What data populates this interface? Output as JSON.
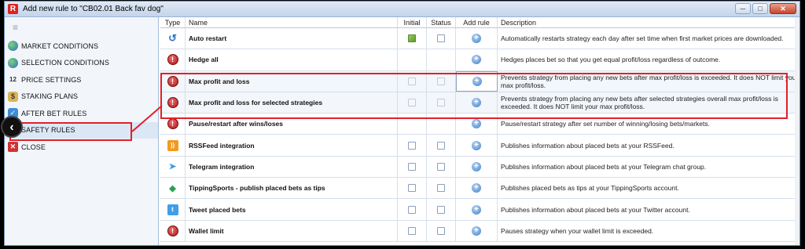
{
  "window": {
    "title": "Add new rule to \"CB02.01 Back fav dog\"",
    "app_icon": "R",
    "buttons": {
      "minimize": "─",
      "maximize": "□",
      "close": "✕"
    }
  },
  "sidebar": {
    "handle": "≡",
    "items": [
      {
        "label": "MARKET CONDITIONS",
        "icon": "globe-icon",
        "glyph": ""
      },
      {
        "label": "SELECTION CONDITIONS",
        "icon": "globe-icon",
        "glyph": ""
      },
      {
        "label": "PRICE SETTINGS",
        "icon": "numbers-icon",
        "glyph": "12"
      },
      {
        "label": "STAKING PLANS",
        "icon": "coins-icon",
        "glyph": "$"
      },
      {
        "label": "AFTER BET RULES",
        "icon": "check-icon",
        "glyph": "✓"
      },
      {
        "label": "SAFETY RULES",
        "icon": "safety-icon",
        "glyph": "!"
      },
      {
        "label": "CLOSE",
        "icon": "close-icon",
        "glyph": "✕"
      }
    ]
  },
  "overlay": {
    "back_glyph": "‹"
  },
  "grid": {
    "headers": {
      "type": "Type",
      "name": "Name",
      "initial": "Initial",
      "status": "Status",
      "add": "Add rule",
      "description": "Description"
    },
    "rows": [
      {
        "type_icon": "restart-icon",
        "type_glyph": "↺",
        "name": "Auto restart",
        "initial": "checked",
        "status": "enabled",
        "description": "Automatically restarts strategy each day after set time when first market prices are downloaded."
      },
      {
        "type_icon": "safety-icon",
        "type_glyph": "!",
        "name": "Hedge all",
        "initial": "none",
        "status": "none",
        "description": "Hedges places bet so that you get equal profit/loss regardless of outcome."
      },
      {
        "type_icon": "safety-icon",
        "type_glyph": "!",
        "name": "Max profit and loss",
        "initial": "disabled",
        "status": "disabled",
        "description": "Prevents strategy from placing any new bets after max profit/loss is exceeded. It does NOT limit your max profit/loss."
      },
      {
        "type_icon": "safety-icon",
        "type_glyph": "!",
        "name": "Max profit and loss for selected strategies",
        "initial": "disabled",
        "status": "disabled",
        "description": "Prevents strategy from placing any new bets after selected strategies overall max profit/loss is exceeded. It does NOT limit your max profit/loss."
      },
      {
        "type_icon": "safety-icon",
        "type_glyph": "!",
        "name": "Pause/restart after wins/loses",
        "initial": "none",
        "status": "none",
        "description": "Pause/restart strategy after set number of winning/losing bets/markets."
      },
      {
        "type_icon": "rss-icon",
        "type_glyph": "))",
        "name": "RSSFeed integration",
        "initial": "enabled",
        "status": "enabled",
        "description": "Publishes information about placed bets at your RSSFeed."
      },
      {
        "type_icon": "telegram-icon",
        "type_glyph": "➤",
        "name": "Telegram integration",
        "initial": "enabled",
        "status": "enabled",
        "description": "Publishes information about placed bets at your Telegram chat group."
      },
      {
        "type_icon": "tipping-icon",
        "type_glyph": "◆",
        "name": "TippingSports - publish placed bets as tips",
        "initial": "enabled",
        "status": "enabled",
        "description": "Publishes placed bets as tips at your TippingSports account."
      },
      {
        "type_icon": "twitter-icon",
        "type_glyph": "t",
        "name": "Tweet placed bets",
        "initial": "enabled",
        "status": "enabled",
        "description": "Publishes information about placed bets at your Twitter account."
      },
      {
        "type_icon": "safety-icon",
        "type_glyph": "!",
        "name": "Wallet limit",
        "initial": "enabled",
        "status": "enabled",
        "description": "Pauses strategy when your wallet limit is exceeded."
      }
    ],
    "add_glyph": "+"
  },
  "colors": {
    "highlight": "#e0202a",
    "accent": "#3d7fc8"
  }
}
